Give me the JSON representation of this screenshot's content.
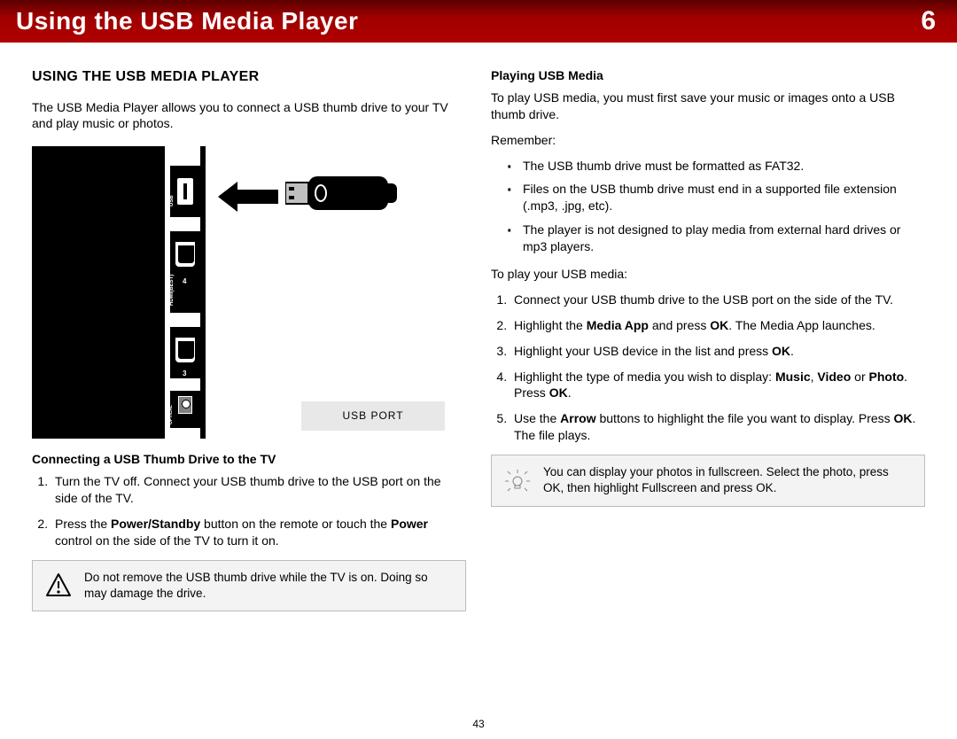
{
  "banner": {
    "title": "Using the USB Media Player",
    "chapter": "6"
  },
  "left": {
    "heading": "Using the USB Media Player",
    "intro": "The USB Media Player allows you to connect a USB thumb drive to your TV and play music or photos.",
    "ports": {
      "usb": "USB",
      "hdmi": "HDMI(BEST)",
      "hdmi_n1": "4",
      "hdmi_n2": "3",
      "optical": "OPTICAL"
    },
    "caption": "USB PORT",
    "sub1": "Connecting a USB Thumb Drive to the TV",
    "steps1_1": "Turn the TV off. Connect your USB thumb drive to the USB port on the side of the TV.",
    "steps1_2a": "Press the ",
    "steps1_2b": "Power/Standby",
    "steps1_2c": " button on the remote or touch the ",
    "steps1_2d": "Power",
    "steps1_2e": " control on the side of the TV to turn it on.",
    "note": "Do not remove the USB thumb drive while the TV is on. Doing so may damage the drive."
  },
  "right": {
    "sub": "Playing USB Media",
    "p1": "To play USB media, you must first save your music or images onto a USB thumb drive.",
    "remember": "Remember:",
    "b1": "The USB thumb drive must be formatted as FAT32.",
    "b2": "Files on the USB thumb drive must end in a supported file extension (.mp3, .jpg, etc).",
    "b3": "The player is not designed to play media from external hard drives or mp3 players.",
    "p2": "To play your USB media:",
    "s1": "Connect your USB thumb drive to the USB port on the side of the TV.",
    "s2a": "Highlight the ",
    "s2b": "Media App",
    "s2c": " and press ",
    "s2d": "OK",
    "s2e": ". The Media App launches.",
    "s3a": "Highlight your USB device in the list and press ",
    "s3b": "OK",
    "s3c": ".",
    "s4a": "Highlight the type of media you wish to display: ",
    "s4b": "Music",
    "s4c": ", ",
    "s4d": "Video",
    "s4e": " or ",
    "s4f": "Photo",
    "s4g": ". Press ",
    "s4h": "OK",
    "s4i": ".",
    "s5a": "Use the ",
    "s5b": "Arrow",
    "s5c": " buttons to highlight the file you want to display. Press ",
    "s5d": "OK",
    "s5e": ". The file plays.",
    "tip": "You can display your photos in fullscreen. Select the photo, press OK, then highlight Fullscreen and press OK."
  },
  "page_number": "43"
}
